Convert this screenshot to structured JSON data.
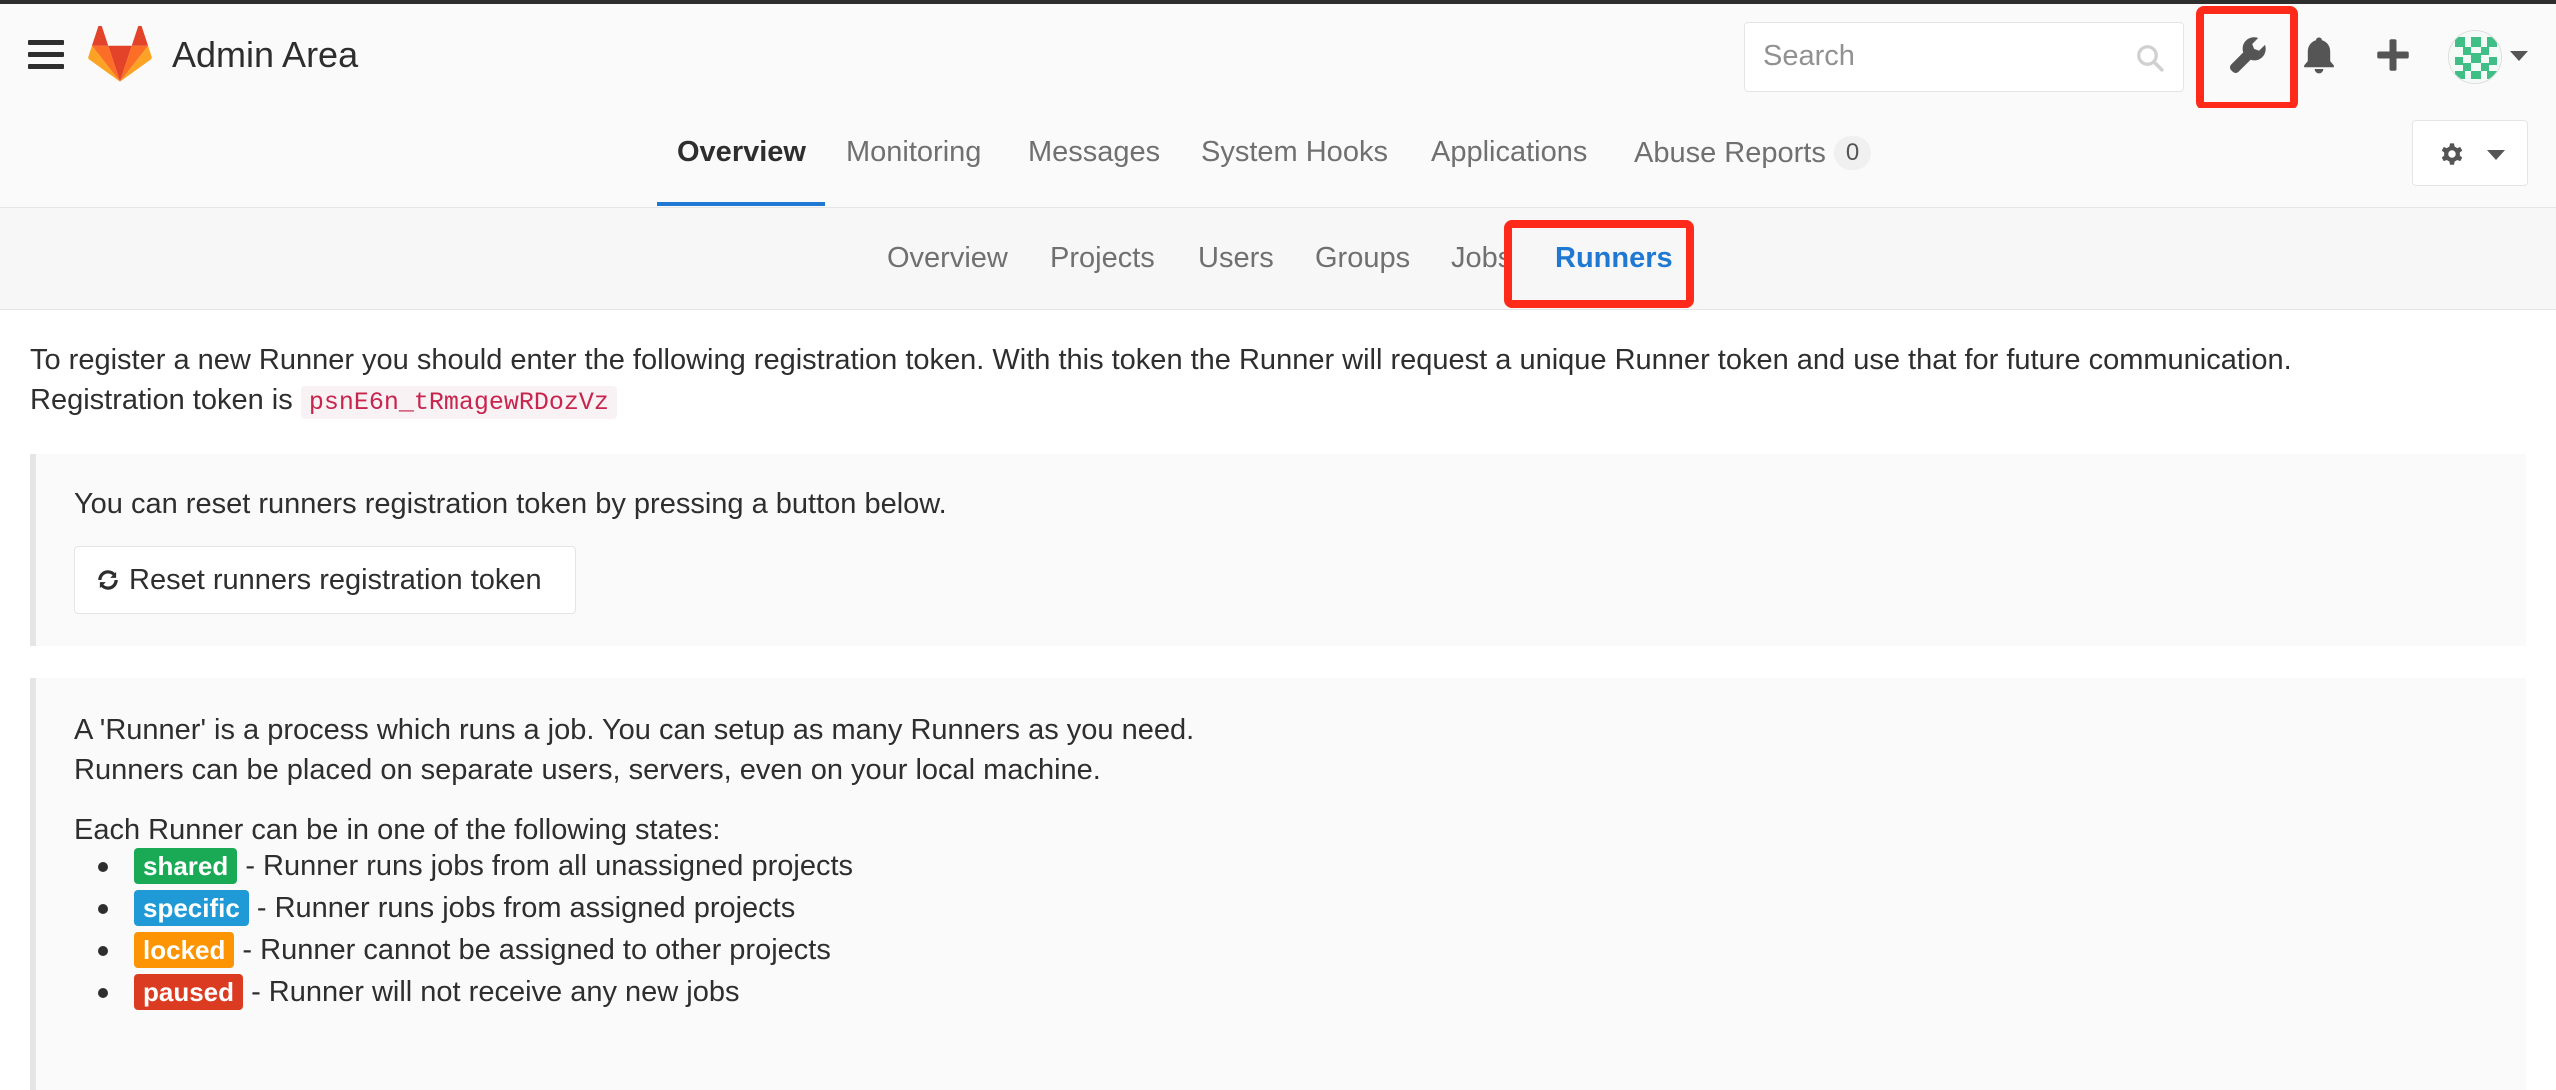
{
  "app": {
    "title": "Admin Area"
  },
  "search": {
    "placeholder": "Search"
  },
  "nav": {
    "tabs": [
      {
        "label": "Overview"
      },
      {
        "label": "Monitoring"
      },
      {
        "label": "Messages"
      },
      {
        "label": "System Hooks"
      },
      {
        "label": "Applications"
      },
      {
        "label": "Abuse Reports",
        "count": "0"
      }
    ],
    "active": "Overview"
  },
  "subnav": {
    "items": [
      {
        "label": "Overview"
      },
      {
        "label": "Projects"
      },
      {
        "label": "Users"
      },
      {
        "label": "Groups"
      },
      {
        "label": "Jobs"
      },
      {
        "label": "Runners"
      }
    ],
    "active": "Runners"
  },
  "content": {
    "intro_line1": "To register a new Runner you should enter the following registration token. With this token the Runner will request a unique Runner token and use that for future communication.",
    "intro_prefix": "Registration token is",
    "token": "psnE6n_tRmagewRDozVz",
    "reset_hint": "You can reset runners registration token by pressing a button below.",
    "reset_button": "Reset runners registration token",
    "about_line1": "A 'Runner' is a process which runs a job. You can setup as many Runners as you need.",
    "about_line2": "Runners can be placed on separate users, servers, even on your local machine.",
    "states_intro": "Each Runner can be in one of the following states:",
    "states": [
      {
        "badge": "shared",
        "color": "#1aaa55",
        "text": " - Runner runs jobs from all unassigned projects"
      },
      {
        "badge": "specific",
        "color": "#1f9ad6",
        "text": " - Runner runs jobs from assigned projects"
      },
      {
        "badge": "locked",
        "color": "#fc9403",
        "text": " - Runner cannot be assigned to other projects"
      },
      {
        "badge": "paused",
        "color": "#db3b21",
        "text": " - Runner will not receive any new jobs"
      }
    ]
  },
  "colors": {
    "accent": "#1f78d1",
    "highlight_box": "#ff2a1a",
    "token_text": "#c7254e"
  },
  "icons": {
    "menu": "hamburger-icon",
    "logo": "gitlab-logo",
    "admin": "wrench-icon",
    "notifications": "bell-icon",
    "new": "plus-icon",
    "settings": "gear-icon",
    "reset": "refresh-icon"
  }
}
